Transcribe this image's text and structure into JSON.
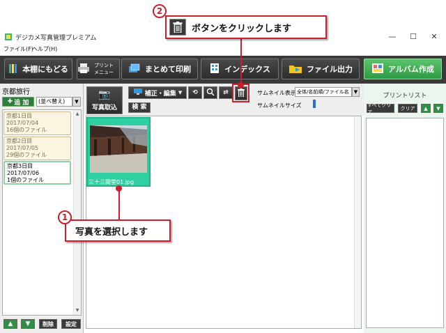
{
  "window": {
    "title": "デジカメ写真管理プレミアム",
    "minimize": "—",
    "maximize": "☐",
    "close": "✕"
  },
  "menu": [
    {
      "label": "ファイル(F)"
    },
    {
      "label": "ヘルプ(H)"
    }
  ],
  "toolbar": {
    "back_label": "本棚にもどる",
    "print_menu_label": "プリント メニュー",
    "batch_print_label": "まとめて印刷",
    "index_label": "インデックス",
    "file_output_label": "ファイル出力",
    "album_create_label": "アルバム作成"
  },
  "left_pane": {
    "album_title": "京都旅行",
    "add_label": "追 加",
    "sort_label": "(並べ替え)",
    "days": [
      {
        "line1": "京都1日目",
        "line2": "2017/07/04",
        "line3": "16個のファイル",
        "selected": false
      },
      {
        "line1": "京都2日目",
        "line2": "2017/07/05",
        "line3": "29個のファイル",
        "selected": false
      },
      {
        "line1": "京都3日目",
        "line2": "2017/07/06",
        "line3": "1個のファイル",
        "selected": true
      }
    ],
    "up_label": "▲",
    "down_label": "▼",
    "delete_label": "削除",
    "settings_label": "設定"
  },
  "center": {
    "import_label": "写真取込",
    "edit_label": "補正・編集",
    "search_label": "検 索",
    "thumb_display_label": "サムネイル表示",
    "thumb_display_value": "全体/名前順/ファイル名",
    "thumb_size_label": "サムネイルサイズ",
    "photos": [
      {
        "caption": "三十三間堂01.jpg",
        "selected": true
      }
    ]
  },
  "right_pane": {
    "title": "プリントリスト",
    "select_all_label": "すべてクリア",
    "clear_label": "クリア",
    "up_label": "▲",
    "down_label": "▼"
  },
  "callouts": {
    "step1_number": "1",
    "step1_text": "写真を選択します",
    "step2_number": "2",
    "step2_text": "ボタンをクリックします"
  },
  "colors": {
    "accent_red": "#cc1e2b",
    "toolbar_dark": "#3a3a3a",
    "album_green": "#2d9a45",
    "selection_teal": "#2ecfa0"
  }
}
